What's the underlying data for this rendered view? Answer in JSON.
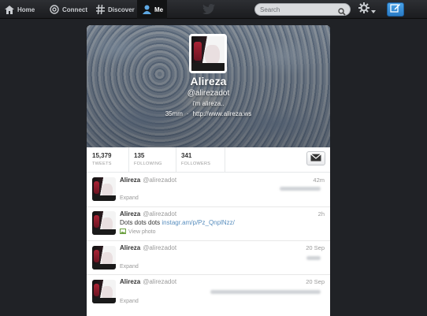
{
  "nav": {
    "items": [
      {
        "label": "Home",
        "icon": "home-icon"
      },
      {
        "label": "Connect",
        "icon": "at-icon"
      },
      {
        "label": "Discover",
        "icon": "hash-icon"
      },
      {
        "label": "Me",
        "icon": "person-icon"
      }
    ],
    "search_placeholder": "Search",
    "colors": {
      "bar": "#1b1c1f",
      "compose": "#2a7cc6"
    }
  },
  "profile": {
    "name": "Alireza",
    "handle": "@alirezadot",
    "bio": "i'm alireza..",
    "location": "35mm",
    "url": "http://www.alireza.ws"
  },
  "stats": [
    {
      "count": "15,379",
      "label": "TWEETS"
    },
    {
      "count": "135",
      "label": "FOLLOWING"
    },
    {
      "count": "341",
      "label": "FOLLOWERS"
    }
  ],
  "tweets": [
    {
      "name": "Alireza",
      "username": "@alirezadot",
      "time": "42m",
      "action": "Expand"
    },
    {
      "name": "Alireza",
      "username": "@alirezadot",
      "time": "2h",
      "text": "Dots dots dots",
      "link": "instagr.am/p/Pz_QnplNzz/",
      "action": "View photo"
    },
    {
      "name": "Alireza",
      "username": "@alirezadot",
      "time": "20 Sep",
      "action": "Expand"
    },
    {
      "name": "Alireza",
      "username": "@alirezadot",
      "time": "20 Sep",
      "action": "Expand"
    }
  ]
}
